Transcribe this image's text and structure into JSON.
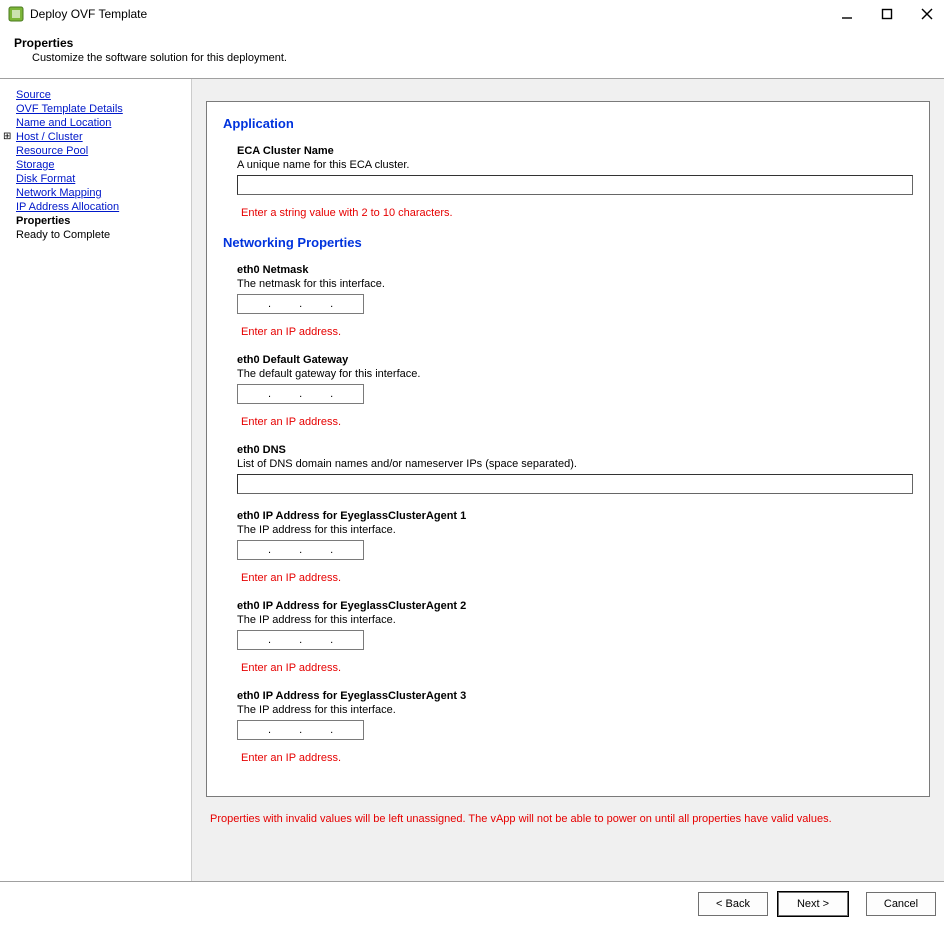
{
  "window": {
    "title": "Deploy OVF Template"
  },
  "header": {
    "title": "Properties",
    "subtitle": "Customize the software solution for this deployment."
  },
  "sidebar": {
    "items": [
      {
        "label": "Source",
        "type": "link"
      },
      {
        "label": "OVF Template Details",
        "type": "link"
      },
      {
        "label": "Name and Location",
        "type": "link"
      },
      {
        "label": "Host / Cluster",
        "type": "link-expandable"
      },
      {
        "label": "Resource Pool",
        "type": "link"
      },
      {
        "label": "Storage",
        "type": "link"
      },
      {
        "label": "Disk Format",
        "type": "link"
      },
      {
        "label": "Network Mapping",
        "type": "link"
      },
      {
        "label": "IP Address Allocation",
        "type": "link"
      },
      {
        "label": "Properties",
        "type": "current"
      },
      {
        "label": "Ready to Complete",
        "type": "disabled"
      }
    ]
  },
  "form": {
    "application": {
      "section_title": "Application",
      "cluster_name": {
        "label": "ECA Cluster Name",
        "desc": "A unique name for this ECA cluster.",
        "value": "",
        "warning": "Enter a string value with 2 to 10 characters."
      }
    },
    "networking": {
      "section_title": "Networking Properties",
      "netmask": {
        "label": "eth0 Netmask",
        "desc": "The netmask for this interface.",
        "value": "",
        "warning": "Enter an IP address."
      },
      "gateway": {
        "label": "eth0 Default Gateway",
        "desc": "The default gateway for this interface.",
        "value": "",
        "warning": "Enter an IP address."
      },
      "dns": {
        "label": "eth0 DNS",
        "desc": "List of DNS domain names and/or nameserver IPs (space separated).",
        "value": ""
      },
      "agent1": {
        "label": "eth0 IP Address for EyeglassClusterAgent 1",
        "desc": "The IP address for this interface.",
        "value": "",
        "warning": "Enter an IP address."
      },
      "agent2": {
        "label": "eth0 IP Address for EyeglassClusterAgent 2",
        "desc": "The IP address for this interface.",
        "value": "",
        "warning": "Enter an IP address."
      },
      "agent3": {
        "label": "eth0 IP Address for EyeglassClusterAgent 3",
        "desc": "The IP address for this interface.",
        "value": "",
        "warning": "Enter an IP address."
      }
    },
    "footer_warning": "Properties with invalid values will be left unassigned. The vApp will not be able to power on until all properties have valid values."
  },
  "buttons": {
    "back": "< Back",
    "next": "Next >",
    "cancel": "Cancel"
  },
  "ip_placeholder": " . . . "
}
